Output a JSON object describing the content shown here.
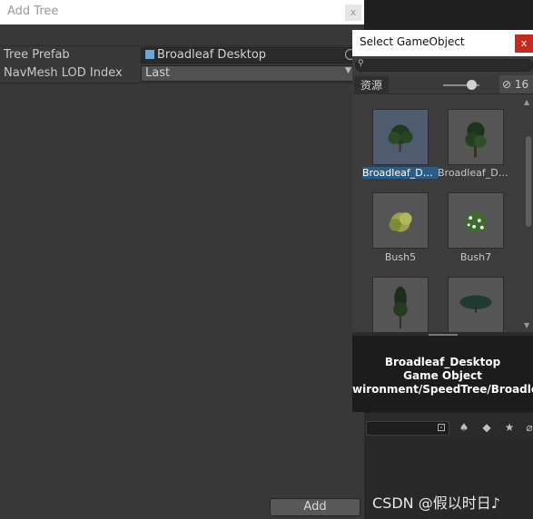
{
  "add_tree": {
    "title": "Add Tree",
    "close_glyph": "x",
    "fields": [
      {
        "label": "Tree Prefab",
        "value": "Broadleaf Desktop"
      },
      {
        "label": "NavMesh LOD Index",
        "value": "Last"
      }
    ],
    "add_button": "Add"
  },
  "select_gameobject": {
    "title": "Select GameObject",
    "close_glyph": "x",
    "tab": "资源",
    "count": "16",
    "items": [
      {
        "label": "Broadleaf_Desktop",
        "selected": true,
        "icon": "tree-thumbnail"
      },
      {
        "label": "Broadleaf_Desktop_Forward",
        "selected": false,
        "icon": "tree-thumbnail"
      },
      {
        "label": "Bush5",
        "selected": false,
        "icon": "bush-thumbnail"
      },
      {
        "label": "Bush7",
        "selected": false,
        "icon": "flower-bush-thumbnail"
      },
      {
        "label": "",
        "selected": false,
        "icon": "conifer-thumbnail"
      },
      {
        "label": "",
        "selected": false,
        "icon": "shrub-thumbnail"
      }
    ],
    "info": {
      "name": "Broadleaf_Desktop",
      "type": "Game Object",
      "path": "wironment/SpeedTree/Broadle"
    }
  },
  "watermark": "CSDN @假以时日♪",
  "colors": {
    "accent": "#2c5d87",
    "close_red": "#c42b1c"
  }
}
